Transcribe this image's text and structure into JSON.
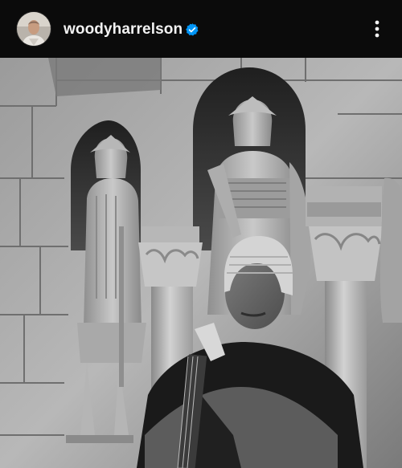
{
  "post": {
    "username": "woodyharrelson",
    "verified": true,
    "photo_mode": "black-and-white"
  },
  "icons": {
    "verified": "verified-badge-icon",
    "more": "more-options-vertical-icon"
  },
  "colors": {
    "header_bg": "#0b0b0b",
    "username_text": "#f2f2f2",
    "verified_blue": "#0095f6"
  }
}
